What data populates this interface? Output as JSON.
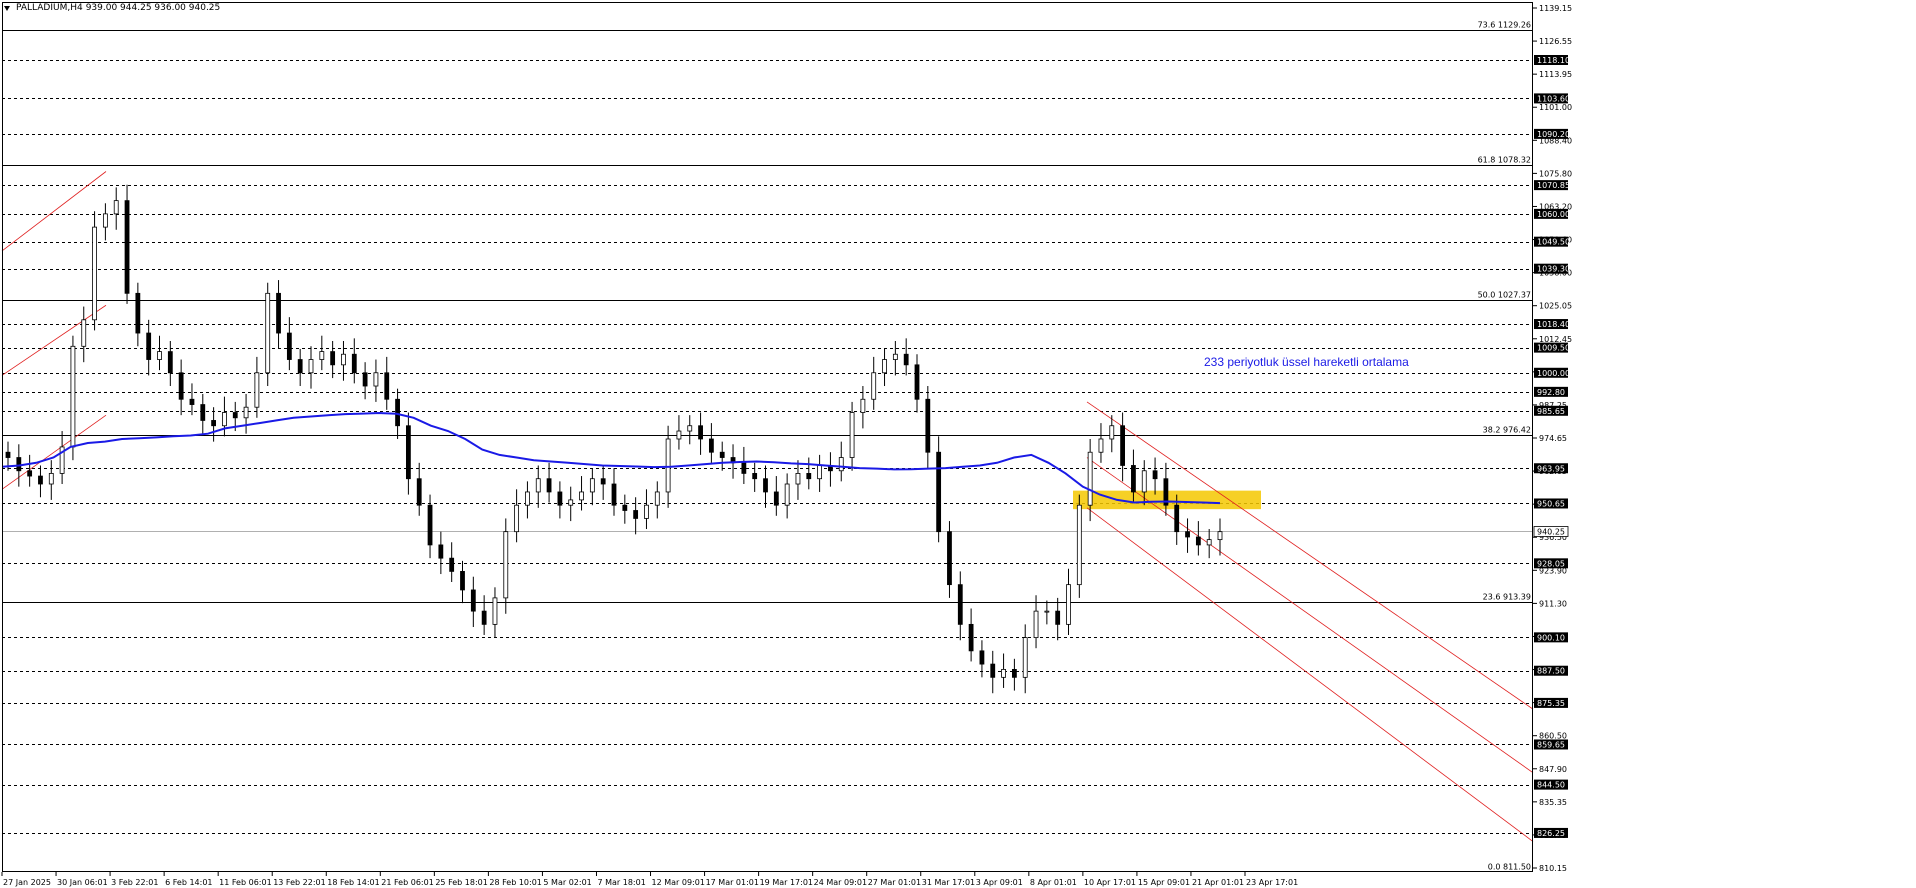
{
  "header": {
    "symbol_label": "PALLADIUM,H4",
    "ohlc": "939.00 944.25 936.00 940.25"
  },
  "annotation": {
    "text": "233 periyotluk üssel hareketli ortalama"
  },
  "colors": {
    "background": "#ffffff",
    "candle": "#000000",
    "ema": "#1a1ae6",
    "channel": "#e02020",
    "highlight_zone": "#f5c800",
    "level_box": "#000000"
  },
  "chart_data": {
    "type": "candlestick",
    "symbol": "PALLADIUM",
    "timeframe": "H4",
    "ylim": [
      811.5,
      1140.0
    ],
    "x_tick_labels": [
      "27 Jan 2025",
      "30 Jan 06:01",
      "3 Feb 22:01",
      "6 Feb 14:01",
      "11 Feb 06:01",
      "13 Feb 22:01",
      "18 Feb 14:01",
      "21 Feb 06:01",
      "25 Feb 18:01",
      "28 Feb 10:01",
      "5 Mar 02:01",
      "7 Mar 18:01",
      "12 Mar 09:01",
      "17 Mar 01:01",
      "19 Mar 17:01",
      "24 Mar 09:01",
      "27 Mar 01:01",
      "31 Mar 17:01",
      "3 Apr 09:01",
      "8 Apr 01:01",
      "10 Apr 17:01",
      "15 Apr 09:01",
      "21 Apr 01:01",
      "23 Apr 17:01"
    ],
    "y_tick_labels": [
      "1139.15",
      "1126.55",
      "1113.95",
      "1101.00",
      "1088.40",
      "1075.80",
      "1063.20",
      "1050.60",
      "1038.00",
      "1025.05",
      "1012.45",
      "999.85",
      "987.25",
      "974.65",
      "962.05",
      "949.45",
      "936.50",
      "923.90",
      "911.30",
      "898.70",
      "886.10",
      "873.50",
      "860.50",
      "847.90",
      "835.35",
      "822.75",
      "810.15"
    ],
    "current_price": "940.25",
    "horizontal_levels": [
      "1118.10",
      "1103.60",
      "1090.20",
      "1070.85",
      "1060.00",
      "1049.50",
      "1039.30",
      "1018.40",
      "1009.50",
      "1000.00",
      "992.80",
      "985.65",
      "963.95",
      "950.65",
      "928.05",
      "900.10",
      "887.50",
      "875.35",
      "859.65",
      "844.50",
      "826.25"
    ],
    "fibonacci": [
      {
        "label": "73.6 1129.26",
        "value": 1129.26
      },
      {
        "label": "61.8 1078.32",
        "value": 1078.32
      },
      {
        "label": "50.0 1027.37",
        "value": 1027.37
      },
      {
        "label": "38.2 976.42",
        "value": 976.42
      },
      {
        "label": "23.6 913.39",
        "value": 913.39
      },
      {
        "label": "0.0 811.50",
        "value": 811.5
      }
    ],
    "ema_period": 233,
    "ema": [
      964.5,
      965,
      966,
      968,
      972,
      973.5,
      974,
      975,
      975.3,
      975.6,
      976,
      976.3,
      977,
      979,
      980,
      981,
      982,
      983,
      983.5,
      984,
      984.4,
      984.6,
      984.8,
      984.5,
      983,
      980,
      978,
      975,
      971,
      969,
      968,
      967,
      966.5,
      966,
      965.5,
      965,
      964.8,
      964.6,
      964.4,
      964.5,
      965,
      965.5,
      966,
      966.3,
      966.5,
      966.2,
      965.8,
      965.5,
      965,
      964.5,
      964,
      963.8,
      963.5,
      963.6,
      963.8,
      964,
      964.5,
      965,
      966,
      968,
      969,
      966,
      962,
      957,
      954,
      952,
      951,
      951.3,
      951.4,
      951.2,
      951,
      950.8
    ],
    "close": [
      968,
      963,
      961,
      958,
      962,
      972,
      1010,
      1020,
      1055,
      1060,
      1065,
      1030,
      1015,
      1005,
      1008,
      1000,
      990,
      988,
      982,
      980,
      985,
      983,
      987,
      1000,
      1030,
      1015,
      1005,
      1000,
      1005,
      1008,
      1003,
      1007,
      1000,
      995,
      1000,
      990,
      980,
      960,
      950,
      935,
      930,
      925,
      918,
      910,
      905,
      915,
      940,
      950,
      955,
      960,
      955,
      950,
      952,
      955,
      960,
      958,
      950,
      948,
      945,
      950,
      955,
      975,
      978,
      980,
      975,
      970,
      968,
      966,
      962,
      960,
      955,
      950,
      958,
      962,
      960,
      965,
      963,
      968,
      985,
      990,
      1000,
      1005,
      1007,
      1003,
      990,
      970,
      940,
      920,
      905,
      895,
      890,
      885,
      888,
      885,
      900,
      910,
      910,
      905,
      920,
      950,
      970,
      975,
      980,
      965,
      955,
      963,
      960,
      950,
      940,
      938,
      935,
      937,
      940
    ]
  }
}
